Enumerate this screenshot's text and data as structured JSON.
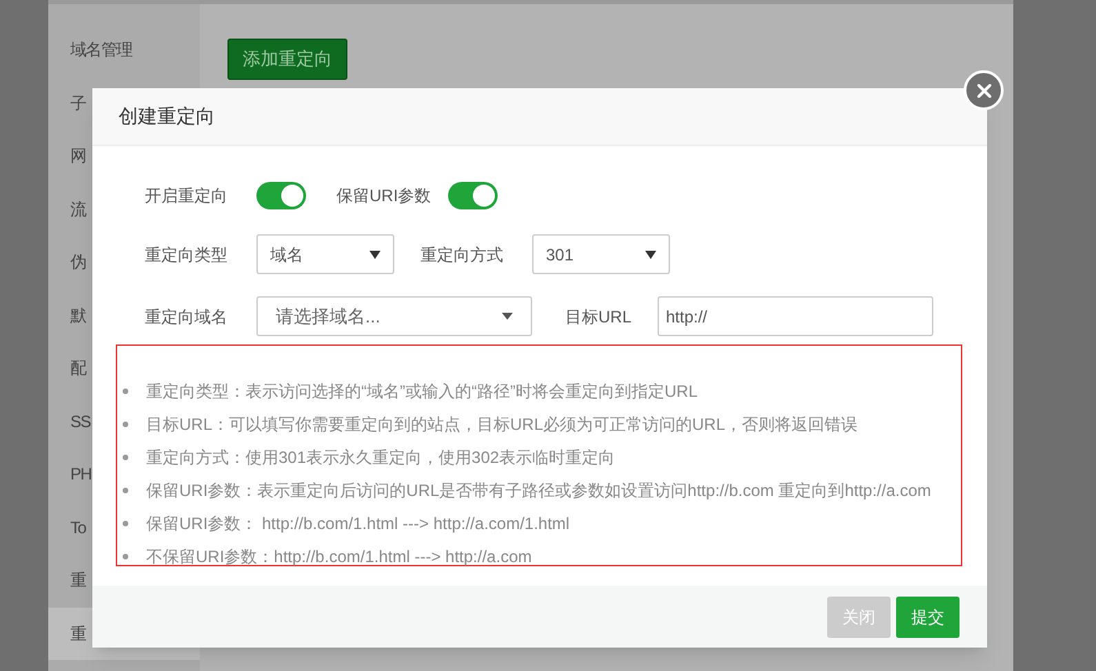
{
  "background": {
    "sidebar": {
      "items": [
        {
          "label": "域名管理",
          "selected": false
        },
        {
          "label": "子",
          "selected": false
        },
        {
          "label": "网",
          "selected": false
        },
        {
          "label": "流",
          "selected": false
        },
        {
          "label": "伪",
          "selected": false
        },
        {
          "label": "默",
          "selected": false
        },
        {
          "label": "配",
          "selected": false
        },
        {
          "label": "SS",
          "selected": false
        },
        {
          "label": "PH",
          "selected": false
        },
        {
          "label": "To",
          "selected": false
        },
        {
          "label": "重",
          "selected": false
        },
        {
          "label": "重",
          "selected": true
        }
      ]
    },
    "add_button": "添加重定向"
  },
  "dialog": {
    "title": "创建重定向",
    "switches": [
      {
        "label": "开启重定向",
        "on": true
      },
      {
        "label": "保留URI参数",
        "on": true
      }
    ],
    "type_row": [
      {
        "label": "重定向类型",
        "value": "域名"
      },
      {
        "label": "重定向方式",
        "value": "301"
      }
    ],
    "domain_row": {
      "label": "重定向域名",
      "placeholder": "请选择域名..."
    },
    "target_url": {
      "label": "目标URL",
      "value": "http://"
    },
    "notes": [
      "重定向类型：表示访问选择的“域名”或输入的“路径”时将会重定向到指定URL",
      "目标URL：可以填写你需要重定向到的站点，目标URL必须为可正常访问的URL，否则将返回错误",
      "重定向方式：使用301表示永久重定向，使用302表示临时重定向",
      "保留URI参数：表示重定向后访问的URL是否带有子路径或参数如设置访问http://b.com 重定向到http://a.com",
      "保留URI参数： http://b.com/1.html ---> http://a.com/1.html",
      "不保留URI参数：http://b.com/1.html ---> http://a.com"
    ],
    "buttons": [
      {
        "label": "关闭",
        "disabled": true
      },
      {
        "label": "提交",
        "disabled": false
      }
    ]
  }
}
